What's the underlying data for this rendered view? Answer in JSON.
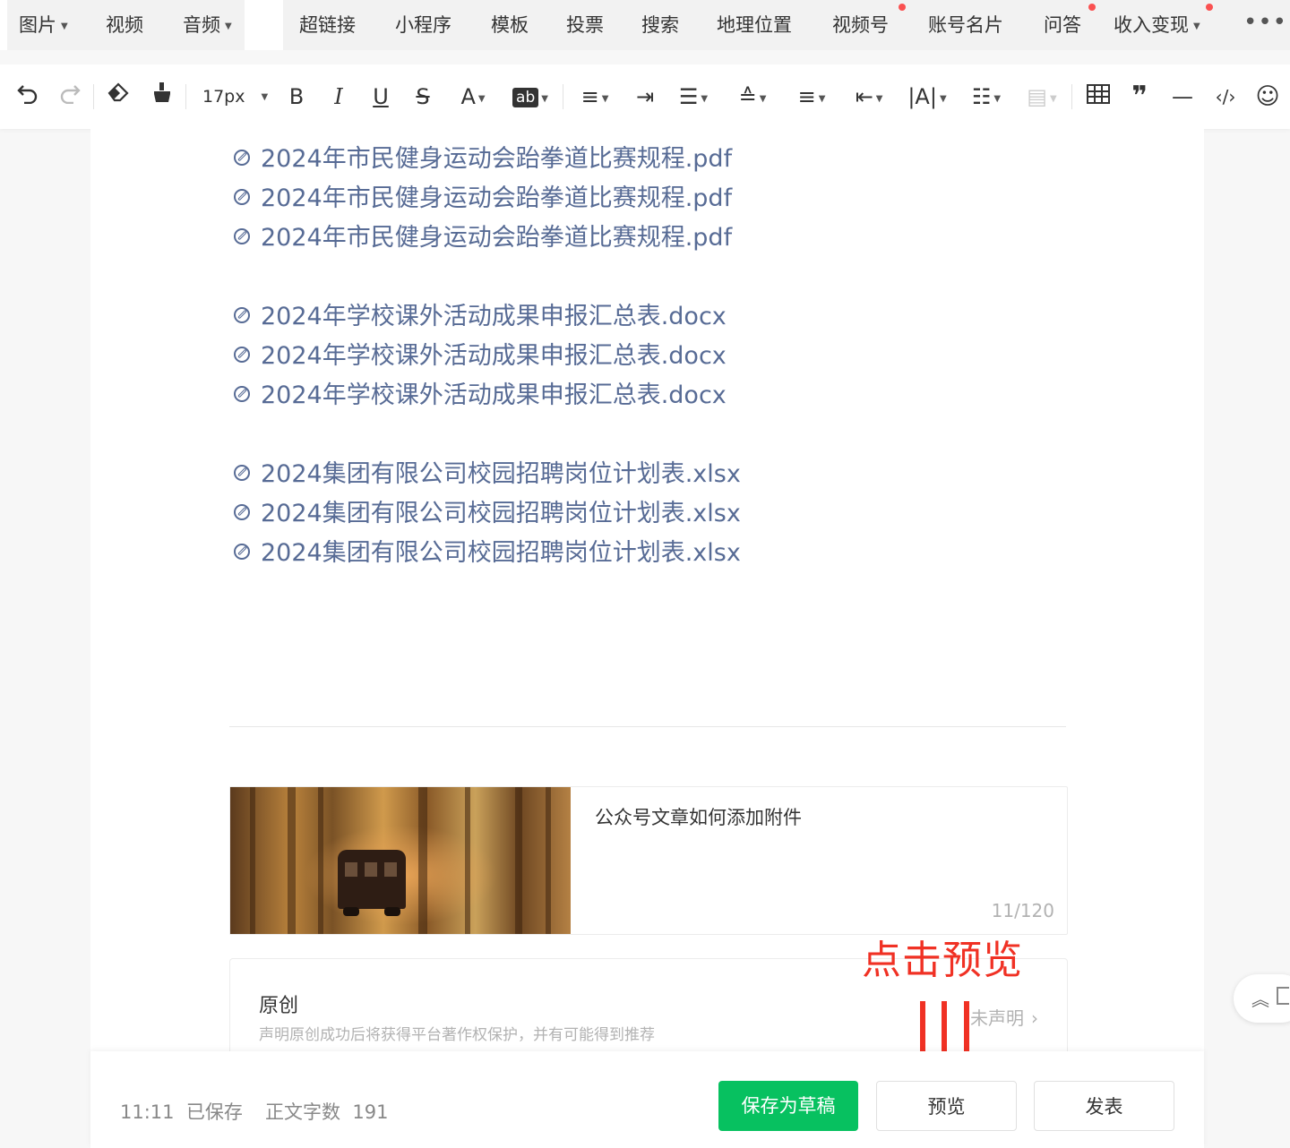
{
  "insert_tabs": [
    {
      "label": "图片",
      "caret": true,
      "dot": false
    },
    {
      "label": "视频",
      "caret": false,
      "dot": false
    },
    {
      "label": "音频",
      "caret": true,
      "dot": false
    },
    {
      "label": "超链接",
      "caret": false,
      "dot": false
    },
    {
      "label": "小程序",
      "caret": false,
      "dot": false
    },
    {
      "label": "模板",
      "caret": false,
      "dot": false
    },
    {
      "label": "投票",
      "caret": false,
      "dot": false
    },
    {
      "label": "搜索",
      "caret": false,
      "dot": false
    },
    {
      "label": "地理位置",
      "caret": false,
      "dot": false
    },
    {
      "label": "视频号",
      "caret": false,
      "dot": true
    },
    {
      "label": "账号名片",
      "caret": false,
      "dot": false
    },
    {
      "label": "问答",
      "caret": false,
      "dot": true
    },
    {
      "label": "收入变现",
      "caret": true,
      "dot": true
    }
  ],
  "toolbar": {
    "font_size": "17px",
    "icons": [
      "undo-icon",
      "redo-icon",
      "eraser-icon",
      "format-brush-icon",
      "bold-icon",
      "italic-icon",
      "underline-icon",
      "strikethrough-icon",
      "font-color-icon",
      "highlight-icon",
      "align-icon",
      "indent-icon",
      "line-height-icon",
      "paragraph-spacing-icon",
      "spacing-before-icon",
      "spacing-after-icon",
      "letter-spacing-icon",
      "list-icon",
      "float-icon",
      "table-icon",
      "quote-icon",
      "horizontal-rule-icon",
      "code-icon",
      "emoji-icon"
    ]
  },
  "editor": {
    "link_groups": [
      [
        "2024年市民健身运动会跆拳道比赛规程.pdf",
        "2024年市民健身运动会跆拳道比赛规程.pdf",
        "2024年市民健身运动会跆拳道比赛规程.pdf"
      ],
      [
        "2024年学校课外活动成果申报汇总表.docx",
        "2024年学校课外活动成果申报汇总表.docx",
        "2024年学校课外活动成果申报汇总表.docx"
      ],
      [
        "2024集团有限公司校园招聘岗位计划表.xlsx",
        "2024集团有限公司校园招聘岗位计划表.xlsx",
        "2024集团有限公司校园招聘岗位计划表.xlsx"
      ]
    ],
    "link_color": "#576b95"
  },
  "cover": {
    "title": "公众号文章如何添加附件",
    "count": "11/120"
  },
  "original": {
    "title": "原创",
    "desc": "声明原创成功后将获得平台著作权保护，并有可能得到推荐",
    "status": "未声明"
  },
  "annotation": {
    "text": "点击预览",
    "color": "#f03124"
  },
  "footer": {
    "time": "11:11",
    "saved": "已保存",
    "word_count_label": "正文字数",
    "word_count": "191",
    "save_draft": "保存为草稿",
    "preview": "预览",
    "publish": "发表"
  },
  "colors": {
    "primary_green": "#07c160",
    "badge_red": "#fa5151"
  }
}
